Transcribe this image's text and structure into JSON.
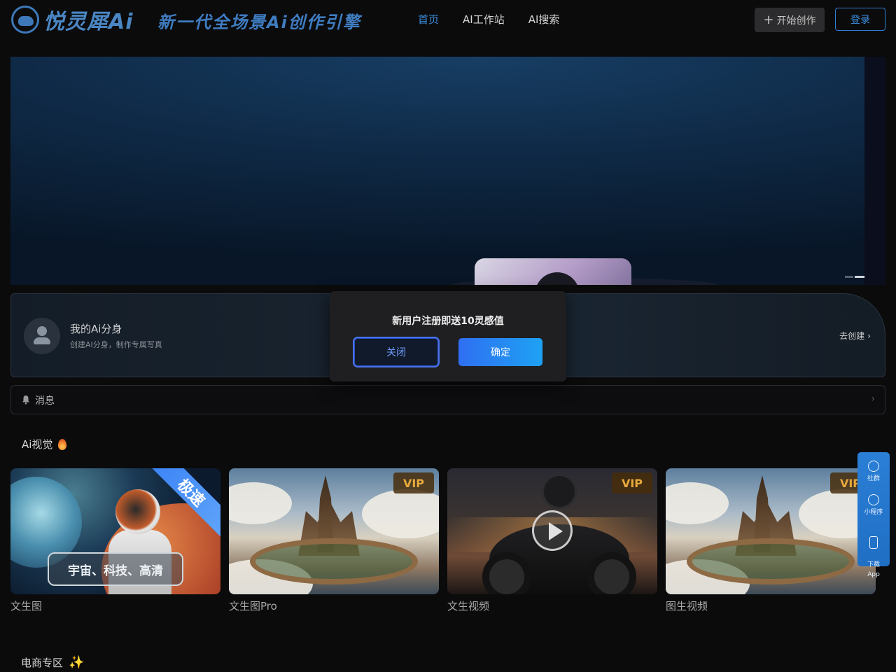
{
  "header": {
    "logo_text": "悦灵犀Ai",
    "slogan": "新一代全场景Ai创作引擎",
    "nav": [
      {
        "label": "首页",
        "active": true
      },
      {
        "label": "AI工作站",
        "active": false
      },
      {
        "label": "AI搜索",
        "active": false
      }
    ],
    "create_button": {
      "icon": "plus-icon",
      "label": "开始创作"
    },
    "login_button": "登录"
  },
  "avatar_card": {
    "title": "我的Ai分身",
    "subtitle": "创建AI分身，制作专属写真",
    "action": "去创建"
  },
  "messages": {
    "label": "消息",
    "icon": "bell-icon"
  },
  "section_ai_vision": {
    "title": "Ai视觉",
    "icon": "flame-icon",
    "tiles": [
      {
        "label": "文生图",
        "badge": "极速",
        "caption": "宇宙、科技、高清"
      },
      {
        "label": "文生图Pro",
        "badge": "VIP"
      },
      {
        "label": "文生视频",
        "badge": "VIP"
      },
      {
        "label": "图生视频",
        "badge": "VIP"
      }
    ]
  },
  "side_panel": {
    "items": [
      "社群",
      "小程序",
      "下载\nApp"
    ]
  },
  "section_ecommerce": {
    "title": "电商专区",
    "icon": "sparkle-icon"
  },
  "modal": {
    "text": "新用户注册即送10灵感值",
    "close_label": "关闭",
    "confirm_label": "确定"
  },
  "colors": {
    "accent": "#3a8fe0",
    "background": "#0b0b0c",
    "vip_gold": "#e7a93c",
    "side_panel": "#2b7fd6"
  }
}
